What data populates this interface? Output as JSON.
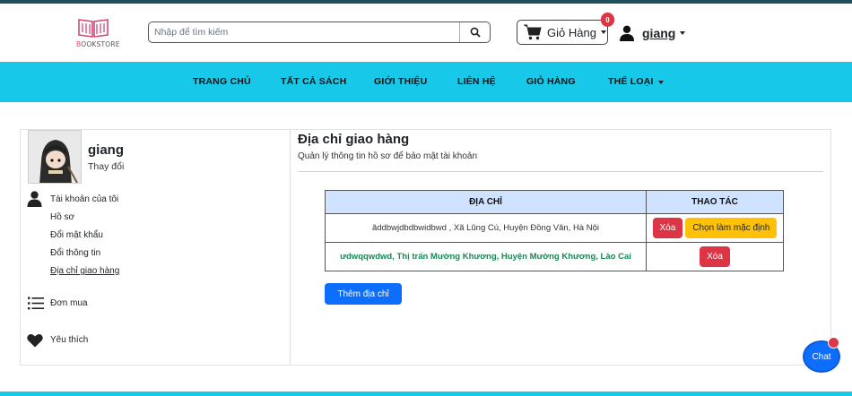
{
  "header": {
    "logo_text_accent": "B",
    "logo_text_rest": "OOKSTORE",
    "search_placeholder": "Nhập để tìm kiếm",
    "cart_label": "Giỏ Hàng",
    "cart_count": "0",
    "user_name": "giang"
  },
  "nav": {
    "items": [
      "TRANG CHỦ",
      "TẤT CẢ SÁCH",
      "GIỚI THIỆU",
      "LIÊN HỆ",
      "GIỎ HÀNG",
      "THỂ LOẠI"
    ]
  },
  "sidebar": {
    "name": "giang",
    "change_label": "Thay đổi",
    "account_label": "Tài khoản của tôi",
    "account_links": [
      "Hồ sơ",
      "Đổi mật khẩu",
      "Đổi thông tin",
      "Địa chỉ giao hàng"
    ],
    "orders_label": "Đơn mua",
    "favorites_label": "Yêu thích"
  },
  "main": {
    "title": "Địa chỉ giao hàng",
    "subtitle": "Quản lý thông tin hồ sơ để bảo mật tài khoản",
    "table": {
      "headers": [
        "ĐỊA CHỈ",
        "THAO TÁC"
      ],
      "rows": [
        {
          "address": "ăddbwjdbdbwidbwd , Xã Lũng Cú, Huyện Đồng Văn, Hà Nội",
          "delete": "Xóa",
          "set_default": "Chọn làm mặc định"
        },
        {
          "address": "ưdwqqwdwd, Thị trấn Mường Khương, Huyện Mường Khương, Lào Cai",
          "delete": "Xóa"
        }
      ]
    },
    "add_button": "Thêm địa chỉ"
  },
  "chat": {
    "label": "Chat"
  },
  "colors": {
    "nav_bg": "#17c8e8",
    "primary": "#0d6efd",
    "danger": "#dc3545",
    "warning": "#ffc107",
    "default_address": "#198754",
    "table_header": "#cfe2ff"
  },
  "icons": [
    "search-icon",
    "cart-icon",
    "user-icon",
    "person-icon",
    "list-icon",
    "heart-icon"
  ]
}
